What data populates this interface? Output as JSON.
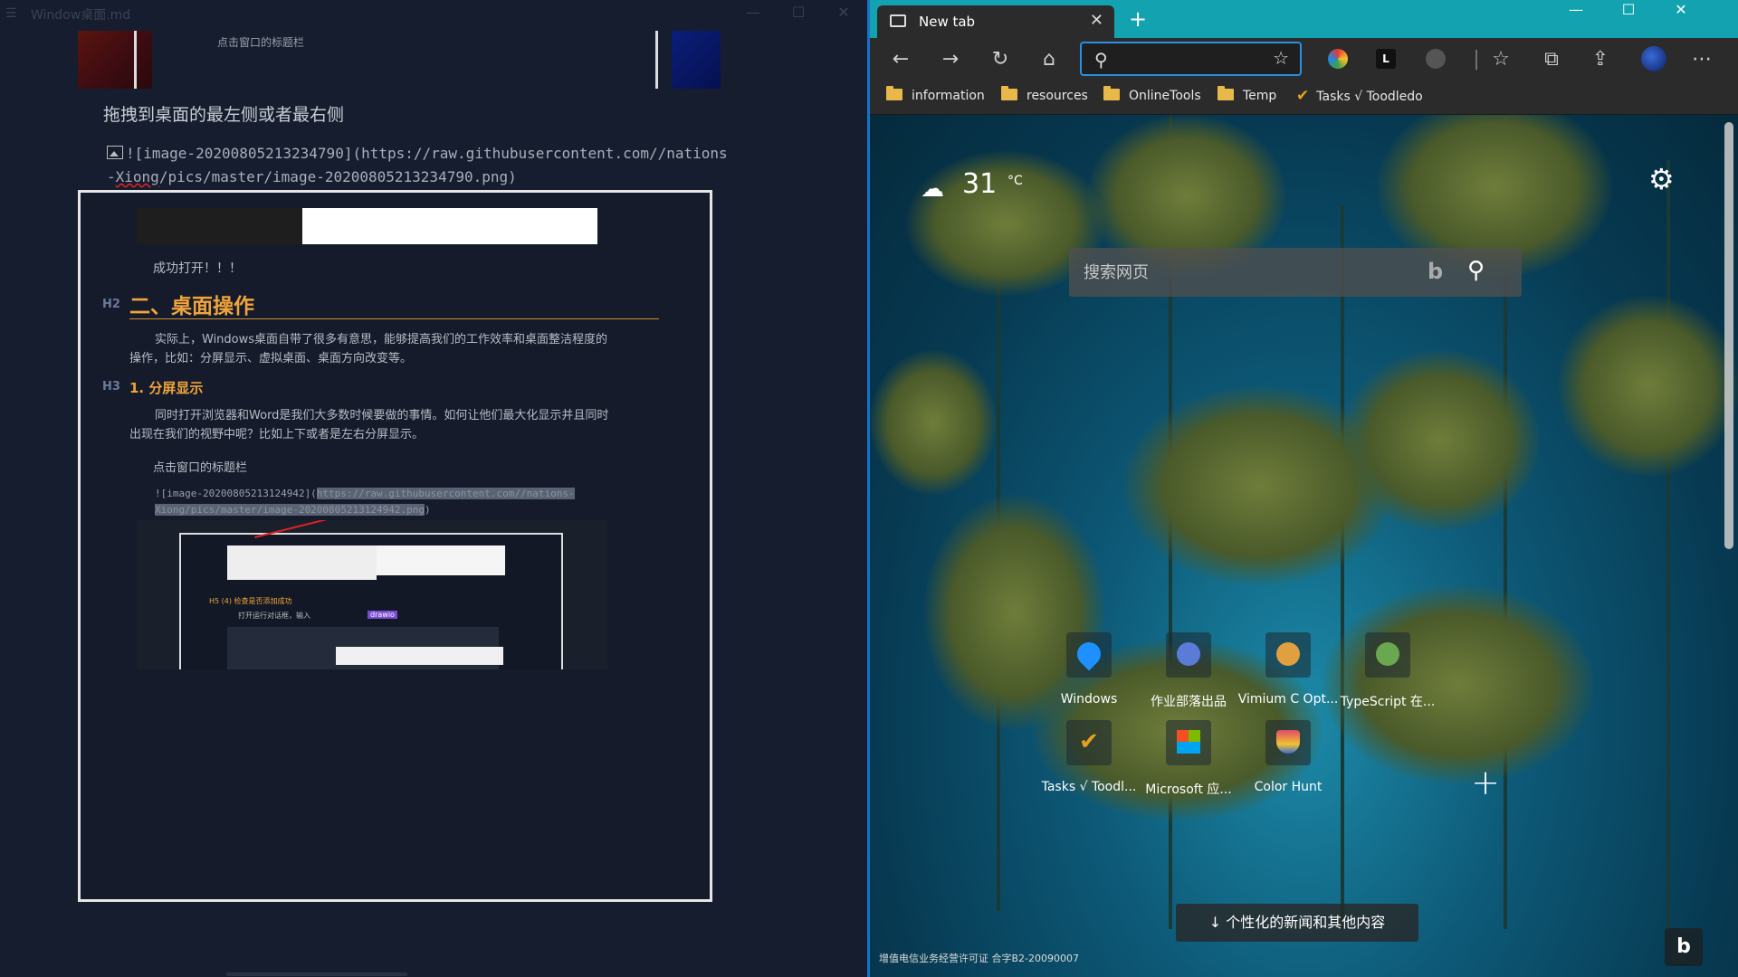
{
  "left": {
    "title": "Window桌面.md",
    "top_thumb_text": "点击窗口的标题栏",
    "line_drag": "拖拽到桌面的最左侧或者最右侧",
    "md_image_1_prefix": "![image-20200805213234790](https://raw.githubusercontent.com//nations",
    "md_image_1_line2a": "-",
    "md_image_1_line2_underlined": "Xiong",
    "md_image_1_line2b": "/pics/master/image-20200805213234790.png)",
    "embedded": {
      "success": "成功打开！！！",
      "h2_tag": "H2",
      "h2": "二、桌面操作",
      "p1": "实际上，Windows桌面自带了很多有意思，能够提高我们的工作效率和桌面整洁程度的操作，比如：分屏显示、虚拟桌面、桌面方向改变等。",
      "h3_tag": "H3",
      "h3": "1. 分屏显示",
      "p2": "同时打开浏览器和Word是我们大多数时候要做的事情。如何让他们最大化显示并且同时出现在我们的视野中呢？比如上下或者是左右分屏显示。",
      "p3": "点击窗口的标题栏",
      "md2_a": "![image-20200805213124942](",
      "md2_sel": "https://raw.githubusercontent.com//nations-Xiong/pics/master/image-20200805213124942.png",
      "md2_b": ")",
      "inner_h5": "H5   (4) 检查是否添加成功",
      "inner_t": "打开运行对话框，输入",
      "inner_tag": "drawio"
    }
  },
  "browser": {
    "tab_title": "New tab",
    "address_value": "",
    "favorites": [
      {
        "label": "information",
        "icon": "folder-icon"
      },
      {
        "label": "resources",
        "icon": "folder-icon"
      },
      {
        "label": "OnlineTools",
        "icon": "folder-icon"
      },
      {
        "label": "Temp",
        "icon": "folder-icon"
      },
      {
        "label": "Tasks √ Toodledo",
        "icon": "check-icon"
      }
    ],
    "weather": {
      "temp": "31",
      "unit": "°C"
    },
    "search_placeholder": "搜索网页",
    "tiles": [
      {
        "label": "Windows",
        "color": "#1e90ff"
      },
      {
        "label": "作业部落出品",
        "color": "#5b7bd8"
      },
      {
        "label": "Vimium C Opt...",
        "color": "#e0a040"
      },
      {
        "label": "TypeScript 在...",
        "color": "#6aa84f"
      },
      {
        "label": "Tasks √ Toodl...",
        "color": "#e8a020"
      },
      {
        "label": "Microsoft 应...",
        "color": "#f25022"
      },
      {
        "label": "Color Hunt",
        "color": "#e04a6a"
      }
    ],
    "news_button": "个性化的新闻和其他内容",
    "icp": "增值电信业务经营许可证  合字B2-20090007"
  }
}
